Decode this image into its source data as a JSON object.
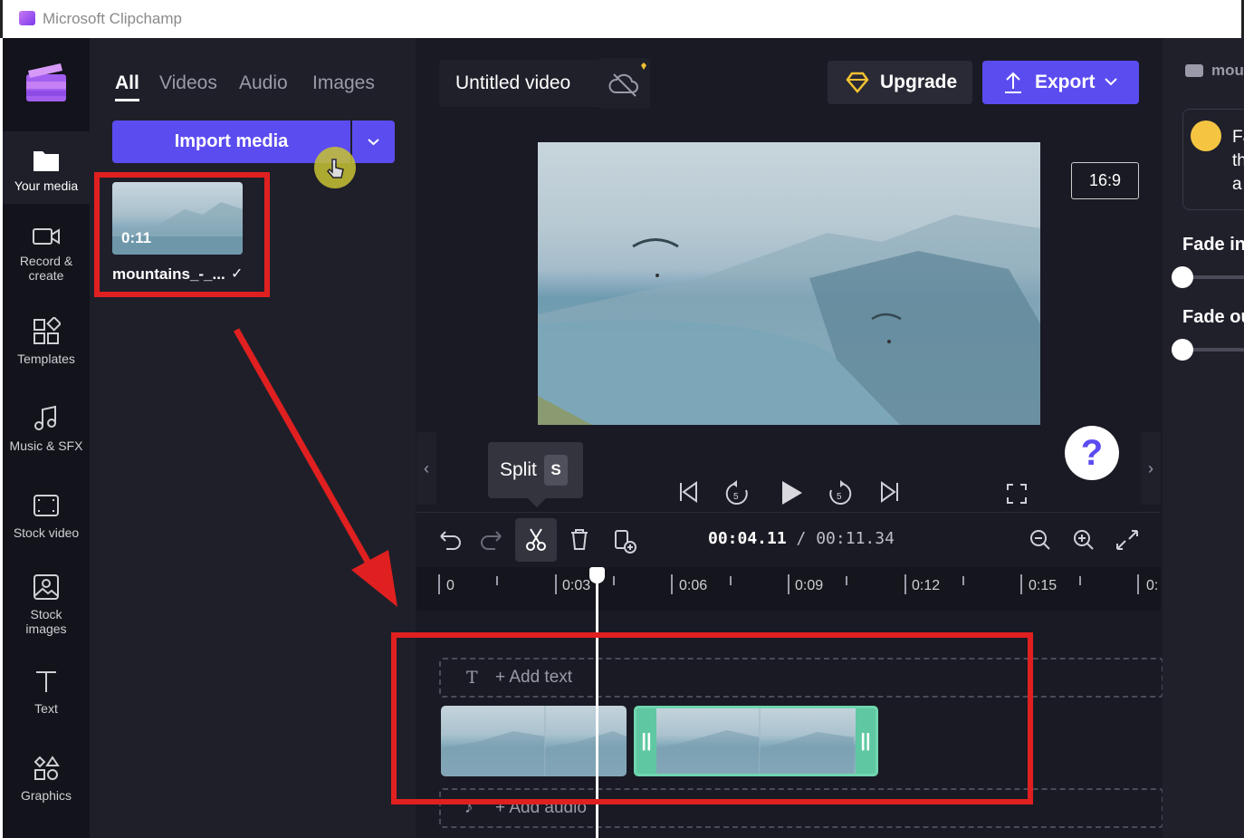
{
  "window": {
    "title": "Microsoft Clipchamp"
  },
  "nav": {
    "items": [
      {
        "label": "Your media"
      },
      {
        "label": "Record &\ncreate"
      },
      {
        "label": "Templates"
      },
      {
        "label": "Music & SFX"
      },
      {
        "label": "Stock video"
      },
      {
        "label": "Stock\nimages"
      },
      {
        "label": "Text"
      },
      {
        "label": "Graphics"
      }
    ]
  },
  "media": {
    "tabs": [
      "All",
      "Videos",
      "Audio",
      "Images"
    ],
    "import_label": "Import media",
    "item": {
      "duration": "0:11",
      "name": "mountains_-_...",
      "check": "✓"
    }
  },
  "header": {
    "project_title": "Untitled video",
    "upgrade_label": "Upgrade",
    "export_label": "Export"
  },
  "preview": {
    "aspect_ratio": "16:9",
    "help": "?",
    "tooltip": {
      "label": "Split",
      "key": "S"
    }
  },
  "timeline": {
    "current_time": "00:04.11",
    "total_time": "/ 00:11.34",
    "ruler": [
      "0",
      "0:03",
      "0:06",
      "0:09",
      "0:12",
      "0:15",
      "0:"
    ],
    "add_text": "+ Add text",
    "add_audio": "+ Add audio",
    "text_track_icon": "T",
    "handle": "||"
  },
  "right_panel": {
    "file_label": "mou",
    "card_text": [
      "Fa",
      "th",
      "a"
    ],
    "fade_in": "Fade in",
    "fade_out": "Fade ou"
  },
  "colors": {
    "accent": "#5b4cf0",
    "highlight": "#e02020",
    "selected_clip": "#6fd6b0"
  }
}
